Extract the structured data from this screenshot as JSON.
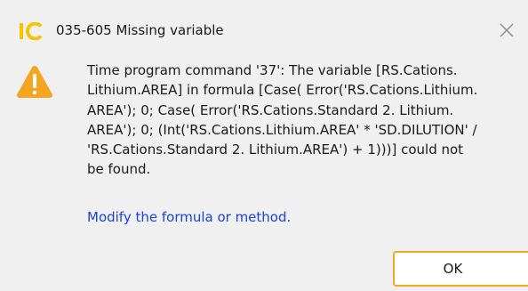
{
  "dialog": {
    "title": "035-605 Missing variable",
    "logo_text": "IC",
    "icons": {
      "app": "ic-logo-icon",
      "warning": "warning-triangle-icon",
      "close": "close-icon"
    },
    "message_lines": [
      "Time program command '37': The variable [RS.Cations.",
      "Lithium.AREA] in formula [Case( Error('RS.Cations.Lithium.",
      "AREA'); 0; Case( Error('RS.Cations.Standard 2. Lithium.",
      "AREA'); 0; (Int('RS.Cations.Lithium.AREA' * 'SD.DILUTION' /",
      "'RS.Cations.Standard 2. Lithium.AREA') + 1)))] could not",
      "be found."
    ],
    "help_link": "Modify the formula or method.",
    "ok_label": "OK"
  },
  "colors": {
    "background": "#f0f0f0",
    "logo_yellow": "#f5c400",
    "warning_orange": "#f4a623",
    "link_blue": "#1b43d8",
    "ok_border": "#f4a623"
  }
}
